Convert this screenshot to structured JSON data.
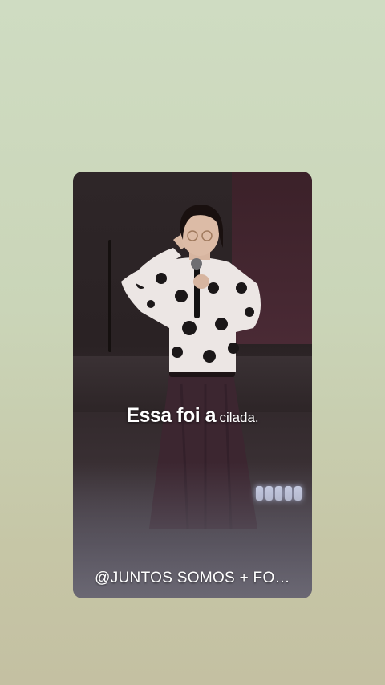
{
  "story": {
    "caption_bold": "Essa foi a",
    "caption_light": "cilada.",
    "handle": "@JUNTOS SOMOS + FO…"
  },
  "colors": {
    "background_top": "#cfdcc2",
    "background_bottom": "#c4c0a2",
    "card_dark": "#2a2224",
    "text": "#ffffff"
  }
}
